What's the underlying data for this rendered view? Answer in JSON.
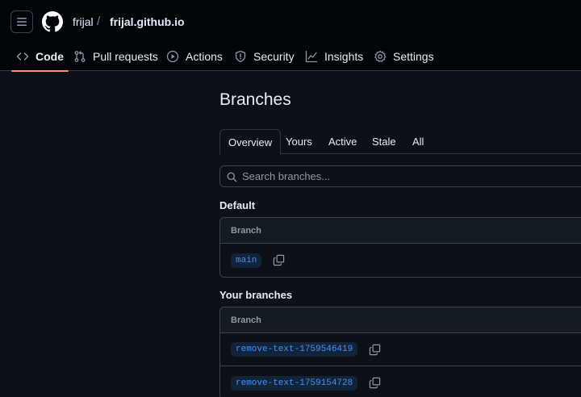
{
  "header": {
    "owner": "frijal",
    "separator": "/",
    "repo": "frijal.github.io"
  },
  "repo_nav": {
    "tabs": [
      {
        "label": "Code",
        "icon": "code-icon",
        "selected": true
      },
      {
        "label": "Pull requests",
        "icon": "git-pull-request-icon"
      },
      {
        "label": "Actions",
        "icon": "play-icon"
      },
      {
        "label": "Security",
        "icon": "shield-icon"
      },
      {
        "label": "Insights",
        "icon": "graph-icon"
      },
      {
        "label": "Settings",
        "icon": "gear-icon"
      }
    ]
  },
  "page": {
    "title": "Branches",
    "subtabs": [
      "Overview",
      "Yours",
      "Active",
      "Stale",
      "All"
    ],
    "selected_subtab": "Overview"
  },
  "search": {
    "placeholder": "Search branches...",
    "value": ""
  },
  "default_section": {
    "heading": "Default",
    "column_header": "Branch",
    "branches": [
      "main"
    ]
  },
  "your_branches_section": {
    "heading": "Your branches",
    "column_header": "Branch",
    "branches": [
      "remove-text-1759546419",
      "remove-text-1759154728"
    ]
  },
  "colors": {
    "background": "#0d1117",
    "header_background": "#010409",
    "border": "#3d444d",
    "text": "#e6edf3",
    "muted": "#9198a1",
    "accent_link": "#4493f8",
    "selected_tab_underline": "#fd8c73"
  }
}
